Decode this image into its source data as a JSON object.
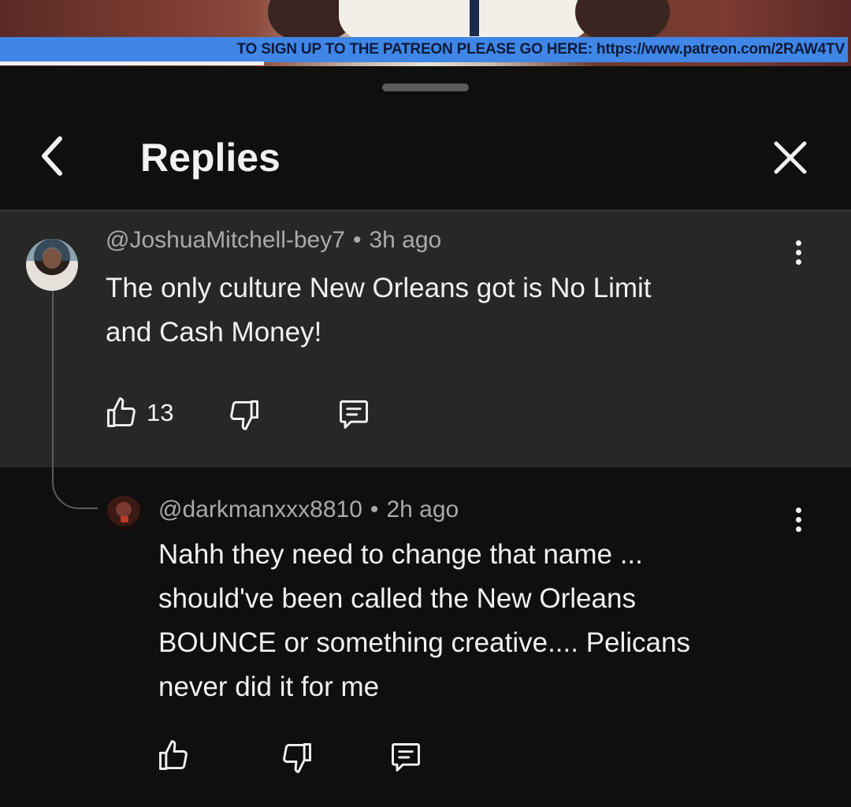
{
  "video": {
    "banner_text": "TO SIGN UP TO THE PATREON PLEASE GO HERE: https://www.patreon.com/2RAW4TV",
    "progress_fraction": 0.31
  },
  "sheet": {
    "title": "Replies",
    "back_icon": "chevron-left-icon",
    "close_icon": "close-icon"
  },
  "parent_comment": {
    "author": "@JoshuaMitchell-bey7",
    "separator": "•",
    "time": "3h ago",
    "text_lines": [
      "The only culture New Orleans got is No Limit",
      "and Cash Money!"
    ],
    "like_count": "13"
  },
  "reply": {
    "author": "@darkmanxxx8810",
    "separator": "•",
    "time": "2h ago",
    "text_lines": [
      "Nahh they need to change that name ...",
      "should've been called the New Orleans",
      "BOUNCE or something creative.... Pelicans",
      "never did it for me"
    ]
  },
  "colors": {
    "background": "#0f0f0f",
    "highlight_row": "#272727",
    "banner": "#3f86e6",
    "meta_text": "#aaaaaa"
  }
}
